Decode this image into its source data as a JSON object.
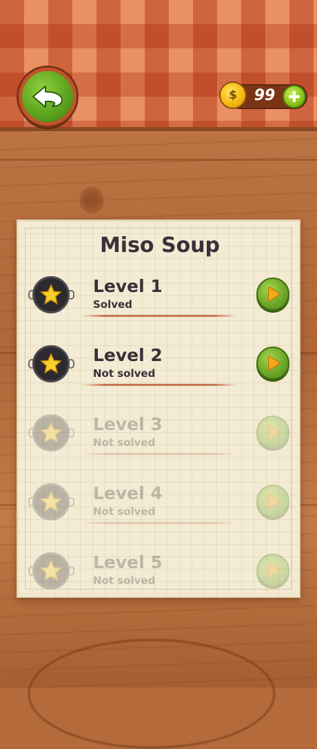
{
  "header": {
    "back_icon": "back-arrow-icon",
    "coins": {
      "icon": "dollar-coin-icon",
      "symbol": "$",
      "count": "99",
      "add_icon": "plus-icon"
    }
  },
  "card": {
    "title": "Miso Soup",
    "levels": [
      {
        "title": "Level 1",
        "status": "Solved",
        "locked": false,
        "star_icon": "star-icon",
        "play_icon": "play-icon"
      },
      {
        "title": "Level 2",
        "status": "Not solved",
        "locked": false,
        "star_icon": "star-icon",
        "play_icon": "play-icon"
      },
      {
        "title": "Level 3",
        "status": "Not solved",
        "locked": true,
        "star_icon": "star-icon",
        "play_icon": "play-icon"
      },
      {
        "title": "Level 4",
        "status": "Not solved",
        "locked": true,
        "star_icon": "star-icon",
        "play_icon": "play-icon"
      },
      {
        "title": "Level 5",
        "status": "Not solved",
        "locked": true,
        "star_icon": "star-icon",
        "play_icon": "play-icon"
      }
    ]
  },
  "colors": {
    "tablecloth": "#e07a4a",
    "wood": "#b56a3c",
    "paper": "#f3ebd3",
    "button_green": "#6ea82a",
    "coin_gold": "#f5b50d",
    "text_dark": "#3b2f3a"
  }
}
